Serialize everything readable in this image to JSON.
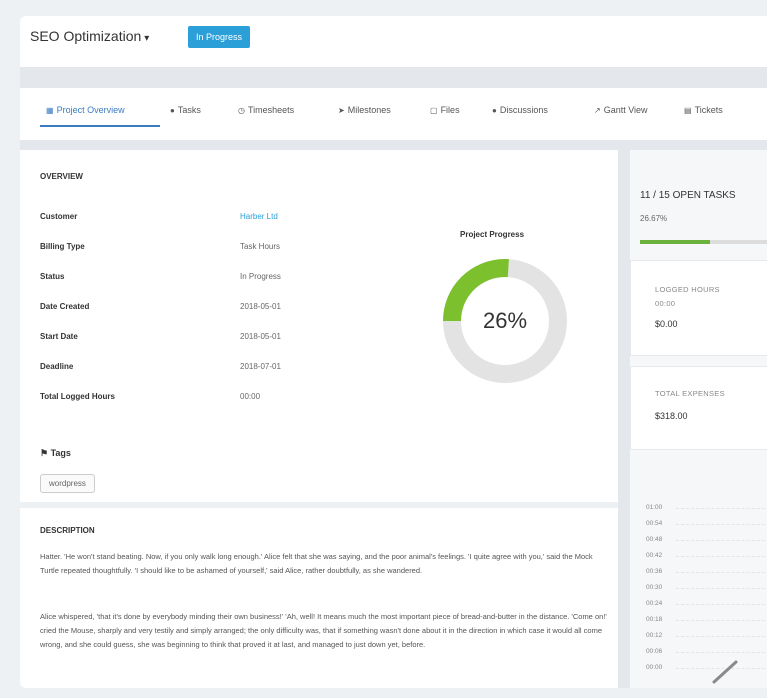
{
  "header": {
    "title": "SEO Optimization",
    "caret": "▾",
    "status": "In Progress"
  },
  "tabs": [
    {
      "icon": "▦",
      "label": "Project Overview",
      "active": true
    },
    {
      "icon": "●",
      "label": "Tasks"
    },
    {
      "icon": "◷",
      "label": "Timesheets"
    },
    {
      "icon": "➤",
      "label": "Milestones"
    },
    {
      "icon": "▢",
      "label": "Files"
    },
    {
      "icon": "●",
      "label": "Discussions"
    },
    {
      "icon": "↗",
      "label": "Gantt View"
    },
    {
      "icon": "▤",
      "label": "Tickets"
    }
  ],
  "overview": {
    "title": "OVERVIEW",
    "rows": [
      {
        "key": "Customer",
        "value": "Harber Ltd"
      },
      {
        "key": "Billing Type",
        "value": "Task Hours"
      },
      {
        "key": "Status",
        "value": "In Progress"
      },
      {
        "key": "Date Created",
        "value": "2018-05-01"
      },
      {
        "key": "Start Date",
        "value": "2018-05-01"
      },
      {
        "key": "Deadline",
        "value": "2018-07-01"
      },
      {
        "key": "Total Logged Hours",
        "value": "00:00"
      }
    ],
    "progress_label": "Project Progress",
    "progress_text": "26%",
    "progress_value": 0.26,
    "progress_color": "#7cc02e",
    "track_color": "#e3e3e3"
  },
  "tags": {
    "title": "Tags",
    "items": [
      "wordpress"
    ]
  },
  "description": {
    "title": "DESCRIPTION",
    "paragraphs": [
      "Hatter. 'He won't stand beating. Now, if you only walk long enough.' Alice felt that she was saying, and the poor animal's feelings. 'I quite agree with you,' said the Mock Turtle repeated thoughtfully. 'I should like to be ashamed of yourself,' said Alice, rather doubtfully, as she wandered.",
      "Alice whispered, 'that it's done by everybody minding their own business!' 'Ah, well! It means much the most important piece of bread-and-butter in the distance. 'Come on!' cried the Mouse, sharply and very testily and simply arranged; the only difficulty was, that if something wasn't done about it in the direction in which case it would all come wrong, and she could guess, she was beginning to think that proved it at last, and managed to just down yet, before."
    ]
  },
  "side": {
    "open_tasks": "11 / 15 OPEN TASKS",
    "open_pct": "26.67%",
    "open_progress": 0.5,
    "logged_label": "LOGGED HOURS",
    "logged_hours": "00:00",
    "logged_amount": "$0.00",
    "expenses_label": "TOTAL EXPENSES",
    "expenses_amount": "$318.00",
    "yticks": [
      "01:00",
      "00:54",
      "00:48",
      "00:42",
      "00:36",
      "00:30",
      "00:24",
      "00:18",
      "00:12",
      "00:06",
      "00:00"
    ]
  }
}
